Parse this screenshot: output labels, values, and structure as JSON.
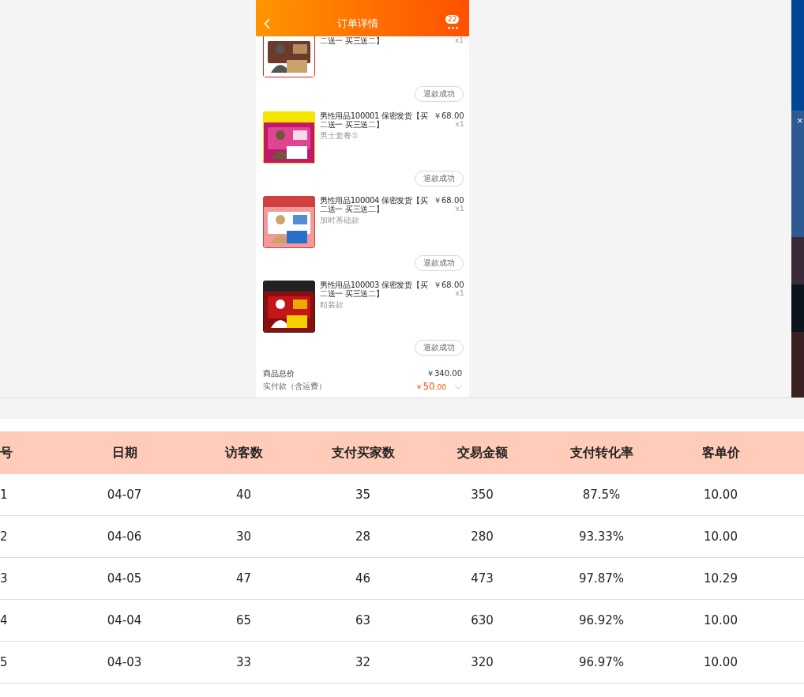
{
  "phone": {
    "title": "订单详情",
    "badge": "22",
    "items": [
      {
        "title": "二送一 买三送二】",
        "quantity": "x1",
        "status_button": "退款成功"
      },
      {
        "title": "男性用品100001 保密发货【买二送一 买三送二】",
        "price": "￥68.00",
        "quantity": "x1",
        "variant": "男士套餐①",
        "status_button": "退款成功"
      },
      {
        "title": "男性用品100004 保密发货【买二送一 买三送二】",
        "price": "￥68.00",
        "quantity": "x1",
        "variant": "加时基础款",
        "status_button": "退款成功"
      },
      {
        "title": "男性用品100003 保密发货【买二送一 买三送二】",
        "price": "￥68.00",
        "quantity": "x1",
        "variant": "精装款",
        "status_button": "退款成功"
      }
    ],
    "goods_total": {
      "label": "商品总价",
      "value": "￥340.00"
    },
    "paid": {
      "label": "实付款（含运费）",
      "currency": "￥",
      "amount": "50",
      "decimals": ".00"
    }
  },
  "side_window": {
    "close": "×"
  },
  "table": {
    "columns": [
      "号",
      "日期",
      "访客数",
      "支付买家数",
      "交易金额",
      "支付转化率",
      "客单价"
    ],
    "rows": [
      [
        "1",
        "04-07",
        "40",
        "35",
        "350",
        "87.5%",
        "10.00"
      ],
      [
        "2",
        "04-06",
        "30",
        "28",
        "280",
        "93.33%",
        "10.00"
      ],
      [
        "3",
        "04-05",
        "47",
        "46",
        "473",
        "97.87%",
        "10.29"
      ],
      [
        "4",
        "04-04",
        "65",
        "63",
        "630",
        "96.92%",
        "10.00"
      ],
      [
        "5",
        "04-03",
        "33",
        "32",
        "320",
        "96.97%",
        "10.00"
      ]
    ]
  }
}
